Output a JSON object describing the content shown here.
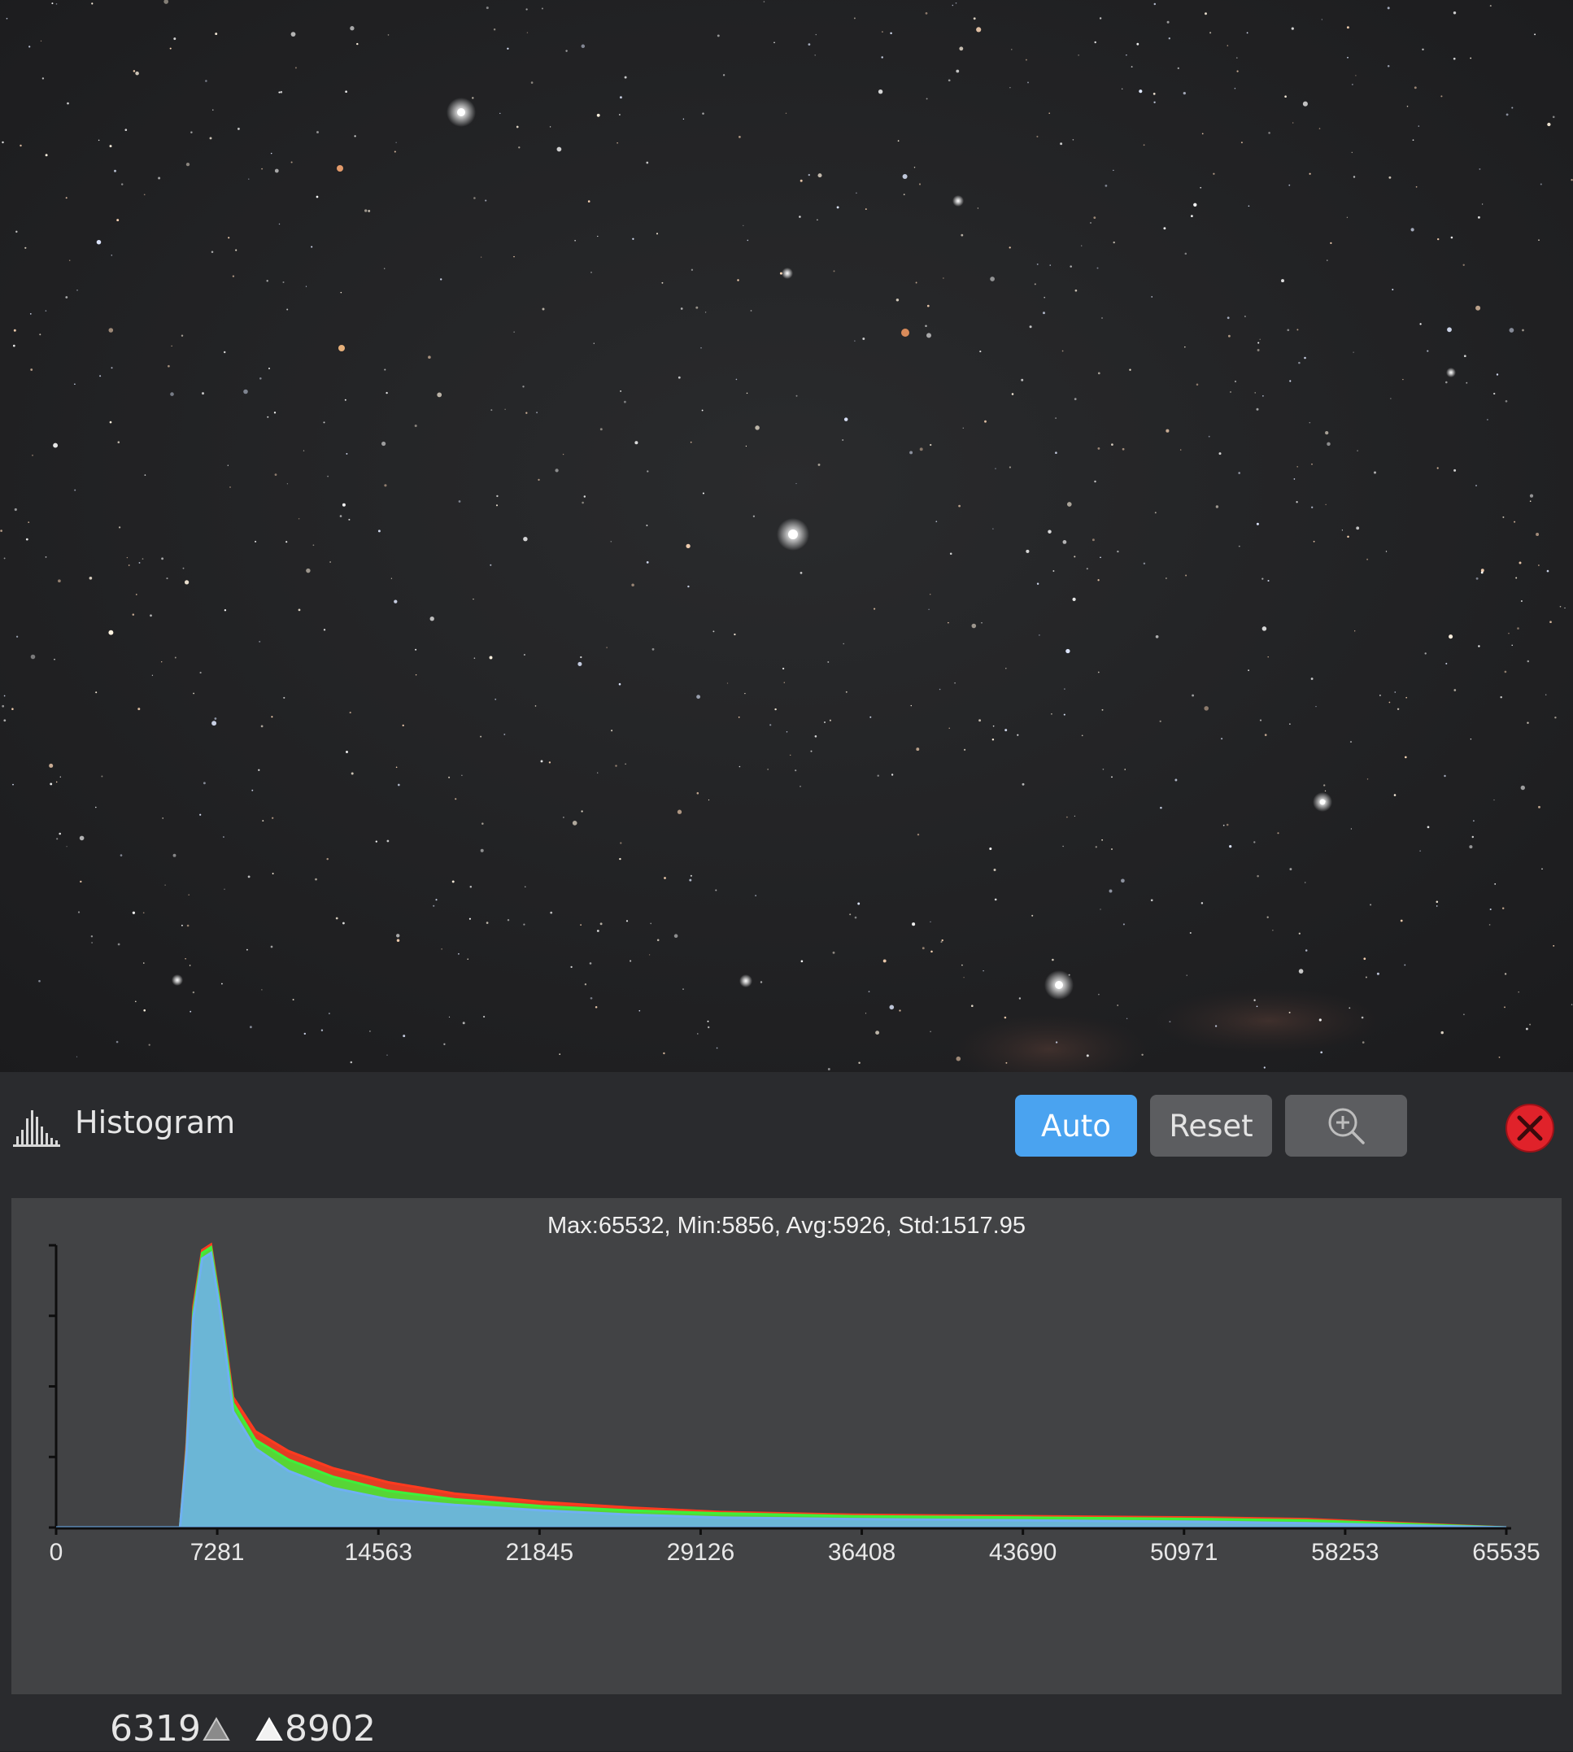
{
  "panel": {
    "title": "Histogram",
    "auto_label": "Auto",
    "reset_label": "Reset",
    "icons": {
      "panel": "histogram-icon",
      "zoom": "zoom-in-icon",
      "close": "close-icon"
    }
  },
  "stats_text": "Max:65532, Min:5856, Avg:5926, Std:1517.95",
  "markers": {
    "low": "6319",
    "high": "8902"
  },
  "colors": {
    "accent": "#4aa3f0",
    "close": "#e0222a",
    "red_channel": "#ff3b1f",
    "green_channel": "#3ef03a",
    "blue_channel": "#6fb0f2"
  },
  "chart_data": {
    "type": "area",
    "xlim": [
      0,
      65535
    ],
    "x_ticks": [
      "0",
      "7281",
      "14563",
      "21845",
      "29126",
      "36408",
      "43690",
      "50971",
      "58253",
      "65535"
    ],
    "grid": false,
    "series": [
      {
        "color": "red",
        "x": [
          0,
          5600,
          5900,
          6200,
          6600,
          7000,
          7400,
          8000,
          9000,
          10500,
          12500,
          15000,
          18000,
          22000,
          26000,
          30000,
          36000,
          44000,
          52000,
          56500,
          65535
        ],
        "y": [
          0,
          0,
          0.3,
          0.78,
          0.98,
          1.0,
          0.8,
          0.46,
          0.34,
          0.27,
          0.21,
          0.16,
          0.12,
          0.09,
          0.07,
          0.055,
          0.045,
          0.04,
          0.035,
          0.03,
          0
        ]
      },
      {
        "color": "green",
        "x": [
          0,
          5600,
          5900,
          6200,
          6600,
          7000,
          7400,
          8000,
          9000,
          10500,
          12500,
          15000,
          18000,
          22000,
          26000,
          30000,
          36000,
          44000,
          52000,
          56500,
          65535
        ],
        "y": [
          0,
          0,
          0.28,
          0.76,
          0.97,
          0.99,
          0.79,
          0.44,
          0.31,
          0.24,
          0.18,
          0.13,
          0.1,
          0.075,
          0.06,
          0.05,
          0.04,
          0.035,
          0.03,
          0.025,
          0
        ]
      },
      {
        "color": "blue",
        "x": [
          0,
          5600,
          5900,
          6200,
          6600,
          7000,
          7400,
          8000,
          9000,
          10500,
          12500,
          15000,
          18000,
          22000,
          26000,
          30000,
          36000,
          44000,
          52000,
          56500,
          65535
        ],
        "y": [
          0,
          0,
          0.27,
          0.74,
          0.95,
          0.97,
          0.77,
          0.41,
          0.28,
          0.2,
          0.14,
          0.1,
          0.08,
          0.06,
          0.045,
          0.035,
          0.03,
          0.025,
          0.02,
          0.015,
          0
        ]
      }
    ]
  }
}
